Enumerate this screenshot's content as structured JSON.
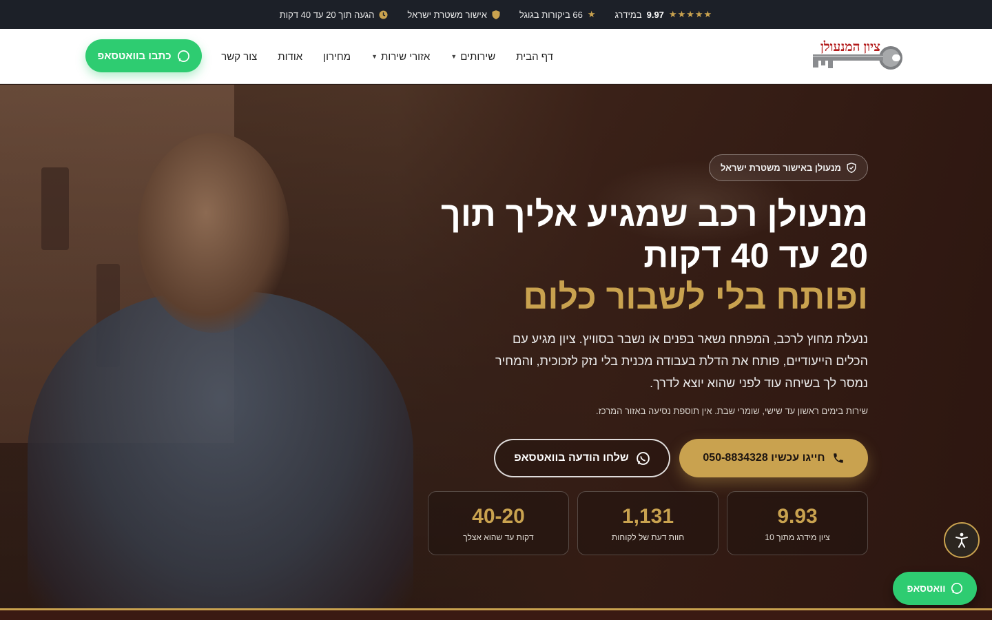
{
  "topbar": {
    "rating_score": "9.97",
    "rating_label": "במידרג",
    "reviews": "66 ביקורות בגוגל",
    "police": "אישור משטרת ישראל",
    "arrival": "הגעה תוך 20 עד 40 דקות",
    "stars": "★★★★★"
  },
  "header": {
    "logo_text": "ציון המנעולן",
    "nav": [
      {
        "label": "דף הבית"
      },
      {
        "label": "שירותים"
      },
      {
        "label": "אזורי שירות"
      },
      {
        "label": "מחירון"
      },
      {
        "label": "אודות"
      },
      {
        "label": "צור קשר"
      }
    ],
    "whatsapp_button": "כתבו בוואטסאפ"
  },
  "hero": {
    "badge": "מנעולן באישור משטרת ישראל",
    "title_line1": "מנעולן רכב שמגיע אליך תוך",
    "title_line2": "20 עד 40 דקות",
    "title_line3": "ופותח בלי לשבור כלום",
    "lead": "ננעלת מחוץ לרכב, המפתח נשאר בפנים או נשבר בסוויץ. ציון מגיע עם הכלים הייעודיים, פותח את הדלת בעבודה מכנית בלי נזק לזכוכית, והמחיר נמסר לך בשיחה עוד לפני שהוא יוצא לדרך.",
    "note": "שירות בימים ראשון עד שישי, שומרי שבת. אין תוספת נסיעה באזור המרכז.",
    "call_button": "חייגו עכשיו 050-8834328",
    "whatsapp_button": "שלחו הודעה בוואטסאפ",
    "stats": [
      {
        "value": "9.93",
        "label": "ציון מידרג מתוך 10"
      },
      {
        "value": "1,131",
        "label": "חוות דעת של לקוחות"
      },
      {
        "value": "40-20",
        "label": "דקות עד שהוא אצלך"
      }
    ]
  },
  "floating": {
    "whatsapp": "וואטסאפ"
  },
  "colors": {
    "accent": "#c9a24f",
    "whatsapp": "#2ecc71",
    "topbar_bg": "#1c2028"
  }
}
